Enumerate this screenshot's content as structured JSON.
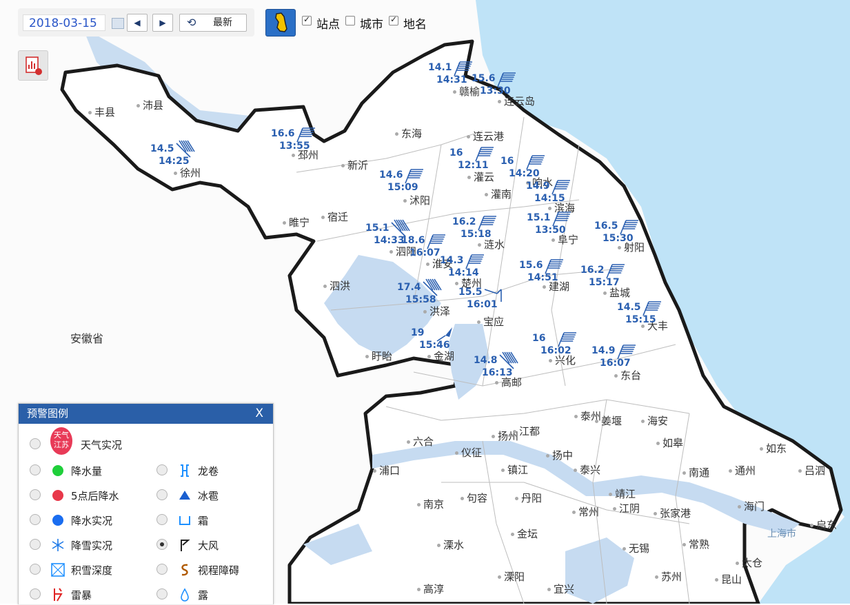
{
  "toolbar": {
    "date_value": "2018-03-15",
    "prev_symbol": "◀",
    "next_symbol": "▶",
    "refresh_label": "最新",
    "layers": [
      {
        "label": "站点",
        "checked": true
      },
      {
        "label": "城市",
        "checked": false
      },
      {
        "label": "地名",
        "checked": true
      }
    ]
  },
  "map": {
    "colors": {
      "land": "#ffffff",
      "outside": "#fbfbfb",
      "sea": "#bfe3f7",
      "water": "#c6dbf1",
      "border": "#222222",
      "accent": "#2a5fb0"
    },
    "outside_label": "安徽省",
    "sea_label": "上海市",
    "places": [
      "丰县",
      "沛县",
      "徐州",
      "邳州",
      "东海",
      "连云港",
      "新沂",
      "赣榆",
      "连云岛",
      "沭阳",
      "灌云",
      "灌南",
      "响水",
      "滨海",
      "宿迁",
      "睢宁",
      "泗阳",
      "涟水",
      "阜宁",
      "射阳",
      "淮安",
      "楚州",
      "建湖",
      "盐城",
      "泗洪",
      "洪泽",
      "宝应",
      "大丰",
      "盱眙",
      "金湖",
      "兴化",
      "东台",
      "高邮",
      "泰州",
      "姜堰",
      "海安",
      "如皋",
      "如东",
      "吕泗",
      "六合",
      "仪征",
      "扬州",
      "江都",
      "浦口",
      "镇江",
      "扬中",
      "泰兴",
      "南通",
      "通州",
      "南京",
      "句容",
      "丹阳",
      "靖江",
      "江阴",
      "张家港",
      "海门",
      "启东",
      "常州",
      "溧水",
      "金坛",
      "无锡",
      "常熟",
      "太仓",
      "高淳",
      "溧阳",
      "宜兴",
      "苏州",
      "昆山"
    ],
    "stations": [
      {
        "speed": "14.1",
        "time": "14:31"
      },
      {
        "speed": "15.6",
        "time": "13:30"
      },
      {
        "speed": "16.6",
        "time": "13:55"
      },
      {
        "speed": "14.5",
        "time": "14:25"
      },
      {
        "speed": "14.6",
        "time": "15:09"
      },
      {
        "speed": "16",
        "time": "12:11"
      },
      {
        "speed": "16",
        "time": "14:20"
      },
      {
        "speed": "14.9",
        "time": "14:15"
      },
      {
        "speed": "15.1",
        "time": "13:50"
      },
      {
        "speed": "16.2",
        "time": "15:18"
      },
      {
        "speed": "16.5",
        "time": "15:30"
      },
      {
        "speed": "15.1",
        "time": "14:33"
      },
      {
        "speed": "18.6",
        "time": "16:07"
      },
      {
        "speed": "14.3",
        "time": "14:14"
      },
      {
        "speed": "15.6",
        "time": "14:51"
      },
      {
        "speed": "16.2",
        "time": "15:17"
      },
      {
        "speed": "17.4",
        "time": "15:58"
      },
      {
        "speed": "15.5",
        "time": "16:01"
      },
      {
        "speed": "14.5",
        "time": "15:15"
      },
      {
        "speed": "19",
        "time": "15:46"
      },
      {
        "speed": "16",
        "time": "16:02"
      },
      {
        "speed": "14.9",
        "time": "16:07"
      },
      {
        "speed": "14.8",
        "time": "16:13"
      }
    ]
  },
  "legend": {
    "title": "预警图例",
    "close_label": "X",
    "items": [
      {
        "label": "天气实况",
        "icon": "weather-stamp-icon",
        "icon_text": "天气江苏",
        "selected": false
      },
      {
        "label": "降水量",
        "icon": "green-dot-icon",
        "color": "#1fcf3a",
        "selected": false
      },
      {
        "label": "龙卷",
        "icon": "tornado-icon",
        "color": "#1e90ff",
        "selected": false
      },
      {
        "label": "5点后降水",
        "icon": "red-dot-icon",
        "color": "#e8384a",
        "selected": false
      },
      {
        "label": "冰雹",
        "icon": "hail-triangle-icon",
        "color": "#1a5fd0",
        "selected": false
      },
      {
        "label": "降水实况",
        "icon": "blue-dot-icon",
        "color": "#1a6df0",
        "selected": false
      },
      {
        "label": "霜",
        "icon": "frost-icon",
        "color": "#1e90ff",
        "selected": false
      },
      {
        "label": "降雪实况",
        "icon": "snowflake-icon",
        "color": "#1e7ae8",
        "selected": false
      },
      {
        "label": "大风",
        "icon": "wind-flag-icon",
        "color": "#222222",
        "selected": true
      },
      {
        "label": "积雪深度",
        "icon": "snow-depth-icon",
        "color": "#1e90ff",
        "selected": false
      },
      {
        "label": "视程障碍",
        "icon": "visibility-icon",
        "color": "#b05a00",
        "selected": false
      },
      {
        "label": "雷暴",
        "icon": "thunder-icon",
        "color": "#e02424",
        "selected": false
      },
      {
        "label": "露",
        "icon": "dew-drop-icon",
        "color": "#1e90ff",
        "selected": false
      }
    ]
  }
}
